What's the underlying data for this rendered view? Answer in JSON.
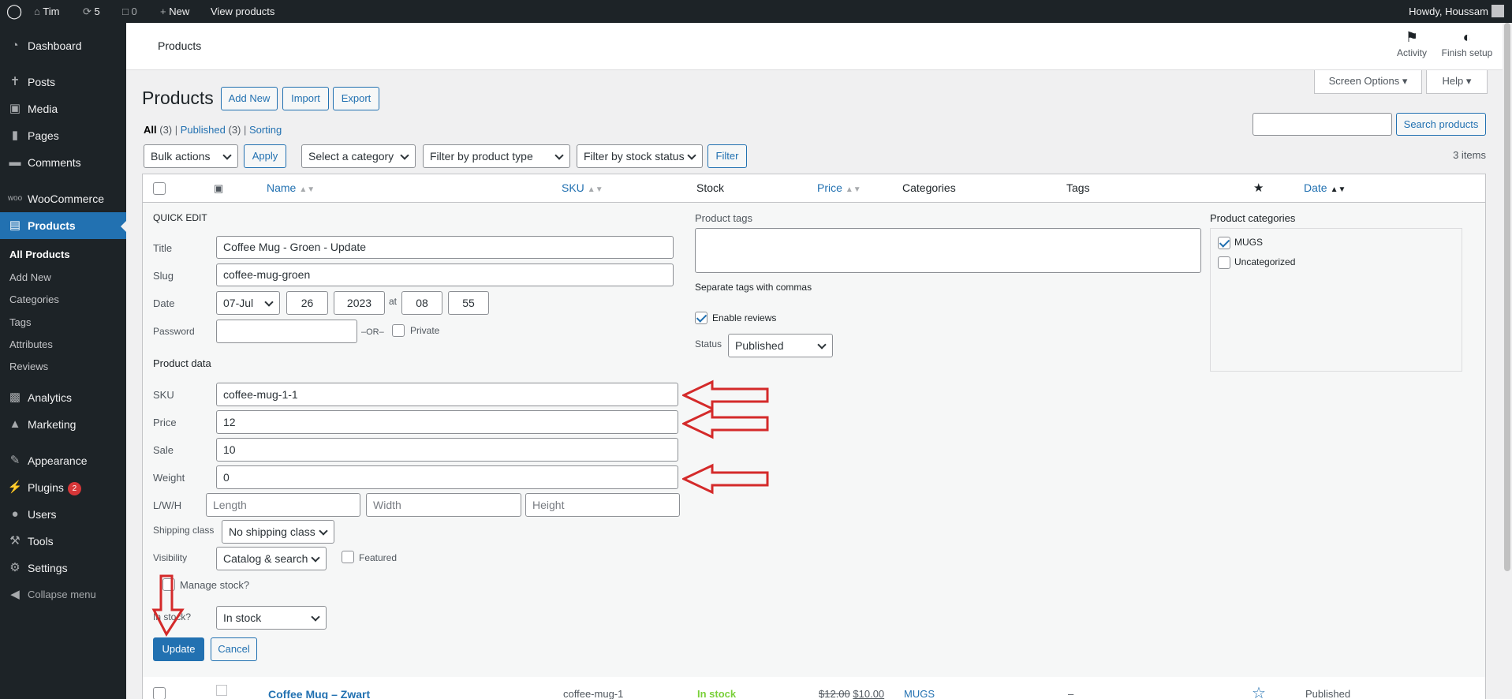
{
  "admin_bar": {
    "site_name": "Tim",
    "updates": "5",
    "comments": "0",
    "new": "New",
    "view": "View products",
    "howdy": "Howdy, Houssam"
  },
  "sidebar": {
    "items": [
      {
        "label": "Dashboard",
        "icon": "dashboard-icon"
      },
      {
        "label": "Posts",
        "icon": "pin-icon"
      },
      {
        "label": "Media",
        "icon": "media-icon"
      },
      {
        "label": "Pages",
        "icon": "page-icon"
      },
      {
        "label": "Comments",
        "icon": "comment-icon"
      },
      {
        "label": "WooCommerce",
        "icon": "woo-icon"
      },
      {
        "label": "Products",
        "icon": "archive-icon"
      },
      {
        "label": "Analytics",
        "icon": "bar-chart-icon"
      },
      {
        "label": "Marketing",
        "icon": "megaphone-icon"
      },
      {
        "label": "Appearance",
        "icon": "brush-icon"
      },
      {
        "label": "Plugins",
        "icon": "plug-icon",
        "badge": "2"
      },
      {
        "label": "Users",
        "icon": "user-icon"
      },
      {
        "label": "Tools",
        "icon": "wrench-icon"
      },
      {
        "label": "Settings",
        "icon": "settings-icon"
      },
      {
        "label": "Collapse menu",
        "icon": "collapse-icon"
      }
    ],
    "submenu": [
      "All Products",
      "Add New",
      "Categories",
      "Tags",
      "Attributes",
      "Reviews"
    ]
  },
  "header": {
    "breadcrumb": "Products",
    "activity": "Activity",
    "finish_setup": "Finish setup",
    "screen_options": "Screen Options",
    "help": "Help"
  },
  "page": {
    "title": "Products",
    "add_new": "Add New",
    "import": "Import",
    "export": "Export",
    "views": {
      "all": "All",
      "all_count": "(3)",
      "published": "Published",
      "published_count": "(3)",
      "sorting": "Sorting"
    },
    "search_button": "Search products",
    "items_count": "3 items",
    "bulk_actions": "Bulk actions",
    "apply": "Apply",
    "category_filter": "Select a category",
    "type_filter": "Filter by product type",
    "stock_filter": "Filter by stock status",
    "filter": "Filter"
  },
  "table": {
    "columns": {
      "name": "Name",
      "sku": "SKU",
      "stock": "Stock",
      "price": "Price",
      "categories": "Categories",
      "tags": "Tags",
      "date": "Date"
    }
  },
  "quick_edit": {
    "heading": "QUICK EDIT",
    "title_label": "Title",
    "title_value": "Coffee Mug - Groen - Update",
    "slug_label": "Slug",
    "slug_value": "coffee-mug-groen",
    "date_label": "Date",
    "month": "07-Jul",
    "day": "26",
    "year": "2023",
    "at": "at",
    "hour": "08",
    "minute": "55",
    "password_label": "Password",
    "or": "–OR–",
    "private": "Private",
    "product_data": "Product data",
    "sku_label": "SKU",
    "sku_value": "coffee-mug-1-1",
    "price_label": "Price",
    "price_value": "12",
    "sale_label": "Sale",
    "sale_value": "10",
    "weight_label": "Weight",
    "weight_value": "0",
    "lwh_label": "L/W/H",
    "length_ph": "Length",
    "width_ph": "Width",
    "height_ph": "Height",
    "shipping_label": "Shipping class",
    "shipping_value": "No shipping class",
    "visibility_label": "Visibility",
    "visibility_value": "Catalog & search",
    "featured": "Featured",
    "manage_stock": "Manage stock?",
    "in_stock_label": "In stock?",
    "in_stock_value": "In stock",
    "update": "Update",
    "cancel": "Cancel",
    "tags_label": "Product tags",
    "tags_hint": "Separate tags with commas",
    "enable_reviews": "Enable reviews",
    "status_label": "Status",
    "status_value": "Published",
    "categories_label": "Product categories",
    "cat_mugs": "MUGS",
    "cat_uncat": "Uncategorized"
  },
  "row": {
    "name": "Coffee Mug – Zwart",
    "sku": "coffee-mug-1",
    "stock": "In stock",
    "price_old": "$12.00",
    "price_new": "$10.00",
    "category": "MUGS",
    "tags": "–",
    "status": "Published"
  },
  "colors": {
    "accent": "#2271b1",
    "annotation": "#d42a2a",
    "in_stock": "#7ad03a"
  }
}
